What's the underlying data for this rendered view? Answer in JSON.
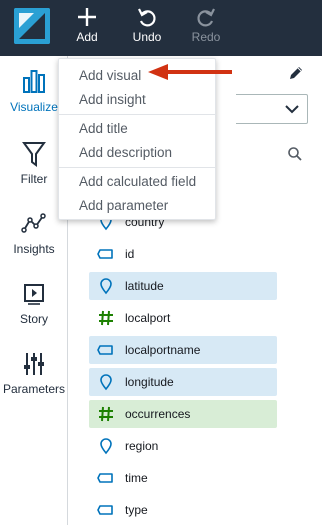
{
  "toolbar": {
    "add_label": "Add",
    "undo_label": "Undo",
    "redo_label": "Redo"
  },
  "sidebar": {
    "items": [
      {
        "label": "Visualize",
        "icon": "bar-chart-icon",
        "active": true
      },
      {
        "label": "Filter",
        "icon": "funnel-icon"
      },
      {
        "label": "Insights",
        "icon": "insights-icon"
      },
      {
        "label": "Story",
        "icon": "story-icon"
      },
      {
        "label": "Parameters",
        "icon": "sliders-icon"
      }
    ]
  },
  "add_menu": {
    "items": [
      {
        "label": "Add visual"
      },
      {
        "label": "Add insight"
      },
      {
        "label": "Add title"
      },
      {
        "label": "Add description"
      },
      {
        "label": "Add calculated field"
      },
      {
        "label": "Add parameter"
      }
    ]
  },
  "fields": [
    {
      "label": "country",
      "type": "geo"
    },
    {
      "label": "id",
      "type": "string"
    },
    {
      "label": "latitude",
      "type": "geo",
      "selected": "dimension"
    },
    {
      "label": "localport",
      "type": "measure"
    },
    {
      "label": "localportname",
      "type": "string",
      "selected": "dimension"
    },
    {
      "label": "longitude",
      "type": "geo",
      "selected": "dimension"
    },
    {
      "label": "occurrences",
      "type": "measure",
      "selected": "measure"
    },
    {
      "label": "region",
      "type": "geo"
    },
    {
      "label": "time",
      "type": "string"
    },
    {
      "label": "type",
      "type": "string"
    }
  ],
  "colors": {
    "topbar": "#232f3e",
    "accent": "#0073bb",
    "dimension_icon": "#0073bb",
    "measure_icon": "#1d8102",
    "dimension_selected_bg": "#d7e9f5",
    "measure_selected_bg": "#d8edd6",
    "annotation_arrow": "#d13212"
  }
}
